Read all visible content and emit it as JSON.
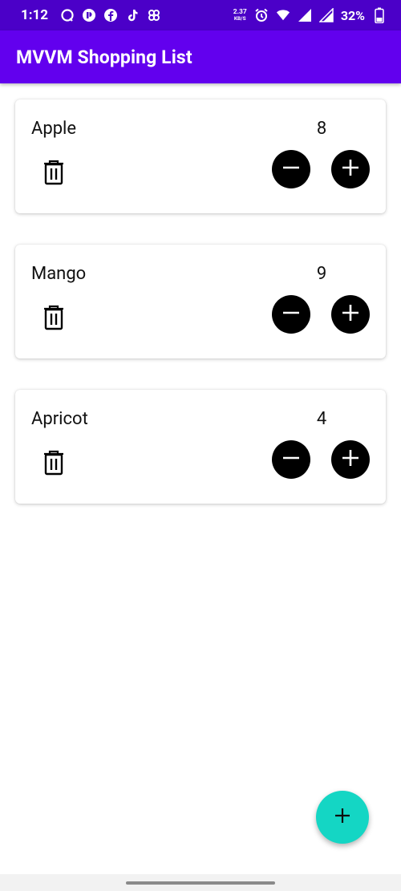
{
  "status_bar": {
    "time": "1:12",
    "net_speed_value": "2.37",
    "net_speed_unit": "KB/S",
    "battery_percent": "32%"
  },
  "app_bar": {
    "title": "MVVM Shopping List"
  },
  "items": [
    {
      "name": "Apple",
      "quantity": "8"
    },
    {
      "name": "Mango",
      "quantity": "9"
    },
    {
      "name": "Apricot",
      "quantity": "4"
    }
  ],
  "colors": {
    "status_bar": "#4b00c8",
    "app_bar": "#6200ee",
    "fab": "#14d6c4",
    "quantity_buttons": "#000000"
  },
  "icons": {
    "delete": "trash-icon",
    "decrement": "minus-circle-icon",
    "increment": "plus-circle-icon",
    "fab": "add-icon"
  }
}
